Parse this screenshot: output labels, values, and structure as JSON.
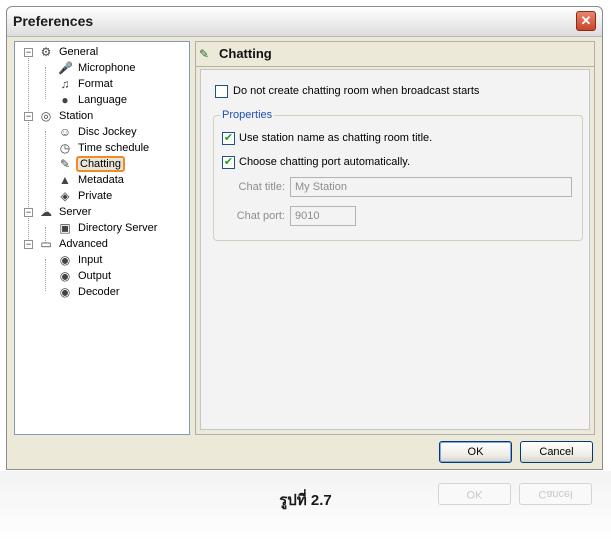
{
  "window": {
    "title": "Preferences",
    "close_glyph": "✕"
  },
  "tree": {
    "nodes": [
      {
        "label": "General",
        "icon": "general-icon",
        "glyph": "⚙",
        "toggle": "−"
      },
      {
        "label": "Microphone",
        "icon": "microphone-icon",
        "glyph": "🎤"
      },
      {
        "label": "Format",
        "icon": "format-icon",
        "glyph": "♫"
      },
      {
        "label": "Language",
        "icon": "language-icon",
        "glyph": "●"
      },
      {
        "label": "Station",
        "icon": "station-icon",
        "glyph": "◎",
        "toggle": "−"
      },
      {
        "label": "Disc Jockey",
        "icon": "disc-jockey-icon",
        "glyph": "☺"
      },
      {
        "label": "Time schedule",
        "icon": "time-schedule-icon",
        "glyph": "◷"
      },
      {
        "label": "Chatting",
        "icon": "chatting-icon",
        "glyph": "✎",
        "selected": true
      },
      {
        "label": "Metadata",
        "icon": "metadata-icon",
        "glyph": "▲"
      },
      {
        "label": "Private",
        "icon": "private-icon",
        "glyph": "◈"
      },
      {
        "label": "Server",
        "icon": "server-icon",
        "glyph": "☁",
        "toggle": "−"
      },
      {
        "label": "Directory Server",
        "icon": "directory-server-icon",
        "glyph": "▣"
      },
      {
        "label": "Advanced",
        "icon": "advanced-icon",
        "glyph": "▭",
        "toggle": "−"
      },
      {
        "label": "Input",
        "icon": "input-icon",
        "glyph": "◉"
      },
      {
        "label": "Output",
        "icon": "output-icon",
        "glyph": "◉"
      },
      {
        "label": "Decoder",
        "icon": "decoder-icon",
        "glyph": "◉"
      }
    ]
  },
  "panel": {
    "title": "Chatting",
    "no_room_checkbox": {
      "label": "Do not create chatting room when broadcast starts",
      "checked": false
    },
    "properties": {
      "legend": "Properties",
      "use_station_name": {
        "label": "Use station name as chatting room title.",
        "checked": true
      },
      "auto_port": {
        "label": "Choose chatting port automatically.",
        "checked": true
      },
      "chat_title": {
        "label": "Chat title:",
        "value": "My Station"
      },
      "chat_port": {
        "label": "Chat port:",
        "value": "9010"
      }
    },
    "checkmark": "✔"
  },
  "buttons": {
    "ok": "OK",
    "cancel": "Cancel"
  },
  "caption": "รูปที่ 2.7",
  "colors": {
    "selection_outline": "#f08a2a",
    "legend": "#1f4fb4",
    "checkmark": "#21a121"
  }
}
